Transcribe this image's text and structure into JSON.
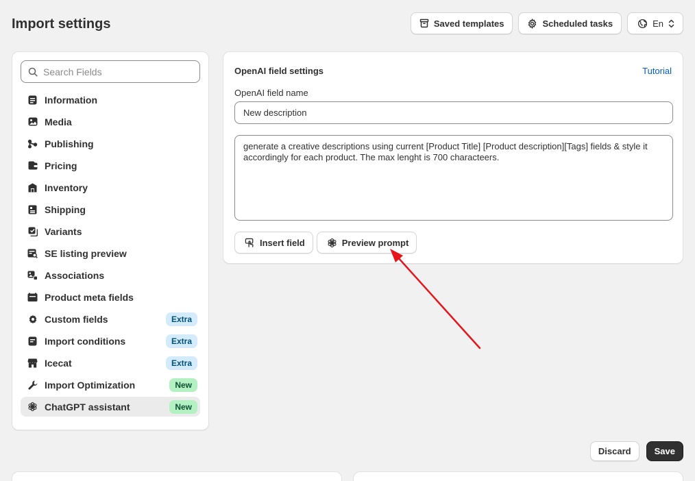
{
  "page": {
    "title": "Import settings"
  },
  "header": {
    "saved_templates": "Saved templates",
    "scheduled_tasks": "Scheduled tasks",
    "language": "En"
  },
  "sidebar": {
    "search_placeholder": "Search Fields",
    "items": [
      {
        "label": "Information",
        "icon": "information-icon"
      },
      {
        "label": "Media",
        "icon": "media-icon"
      },
      {
        "label": "Publishing",
        "icon": "publishing-icon"
      },
      {
        "label": "Pricing",
        "icon": "pricing-icon"
      },
      {
        "label": "Inventory",
        "icon": "inventory-icon"
      },
      {
        "label": "Shipping",
        "icon": "shipping-icon"
      },
      {
        "label": "Variants",
        "icon": "variants-icon"
      },
      {
        "label": "SE listing preview",
        "icon": "se-listing-icon"
      },
      {
        "label": "Associations",
        "icon": "associations-icon"
      },
      {
        "label": "Product meta fields",
        "icon": "meta-fields-icon"
      },
      {
        "label": "Custom fields",
        "icon": "gear-icon",
        "badge": "Extra"
      },
      {
        "label": "Import conditions",
        "icon": "conditions-icon",
        "badge": "Extra"
      },
      {
        "label": "Icecat",
        "icon": "store-icon",
        "badge": "Extra"
      },
      {
        "label": "Import Optimization",
        "icon": "wrench-icon",
        "badge": "New"
      },
      {
        "label": "ChatGPT assistant",
        "icon": "openai-icon",
        "badge": "New",
        "active": true
      }
    ]
  },
  "main": {
    "title": "OpenAI field settings",
    "tutorial": "Tutorial",
    "field_label": "OpenAI field name",
    "field_value": "New description",
    "prompt": "generate a creative descriptions using current [Product Title] [Product description][Tags] fields & style it accordingly for each product. The max lenght is 700 characteers.",
    "insert_field": "Insert field",
    "preview_prompt": "Preview prompt"
  },
  "footer": {
    "discard": "Discard",
    "save": "Save"
  },
  "colors": {
    "background": "#f1f1f1",
    "link": "#005bd3",
    "badge_extra_bg": "#d4ebfb",
    "badge_new_bg": "#b4f1c2",
    "primary_button": "#303030",
    "annotation_arrow": "#e8141b"
  }
}
